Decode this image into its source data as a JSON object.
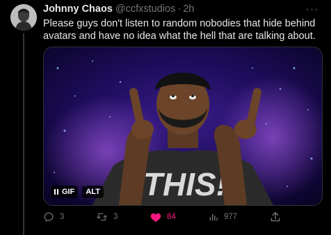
{
  "tweet": {
    "author_name": "Johnny Chaos",
    "handle": "@ccfxstudios",
    "separator": "·",
    "time": "2h",
    "more": "···",
    "text": "Please guys don't listen to random nobodies that hide behind avatars and have no idea what the hell that are talking about."
  },
  "media": {
    "overlay_text": "THIS!",
    "gif_label": "GIF",
    "alt_label": "ALT"
  },
  "actions": {
    "reply_count": "3",
    "retweet_count": "3",
    "like_count": "84",
    "views_count": "977",
    "like_color": "#f91880"
  },
  "colors": {
    "background": "#000000",
    "text": "#e7e9ea",
    "muted": "#71767b",
    "accent_like": "#f91880"
  },
  "icons": [
    "avatar",
    "more-dots-icon",
    "pause-icon",
    "reply-icon",
    "retweet-icon",
    "heart-icon",
    "views-icon",
    "share-icon"
  ]
}
